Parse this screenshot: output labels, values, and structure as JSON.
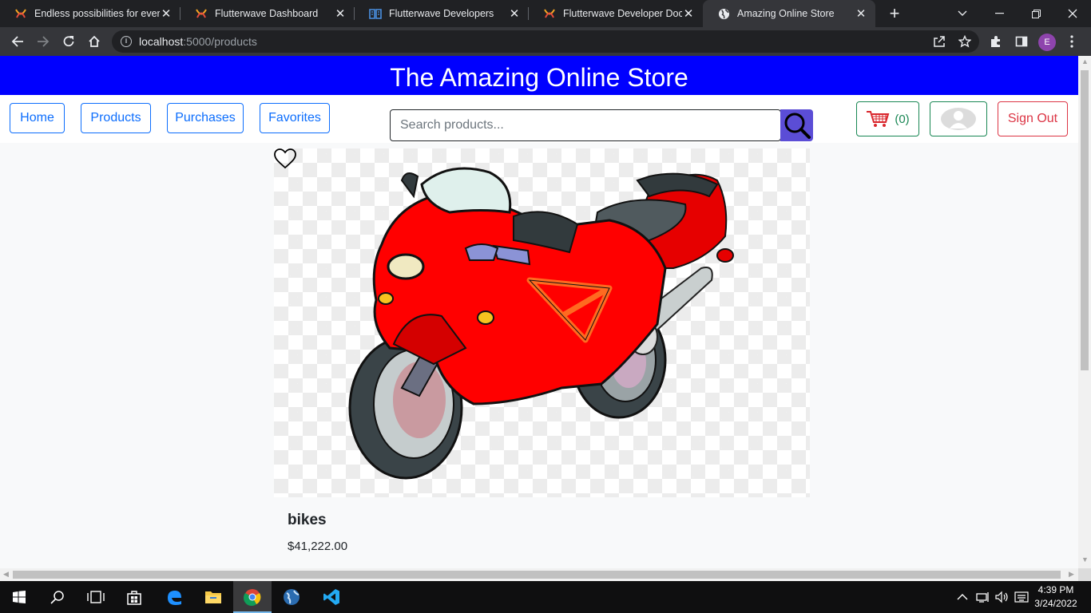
{
  "browser": {
    "tabs": [
      {
        "title": "Endless possibilities for every",
        "icon": "flutterwave-icon"
      },
      {
        "title": "Flutterwave Dashboard",
        "icon": "flutterwave-icon"
      },
      {
        "title": "Flutterwave Developers",
        "icon": "book-icon"
      },
      {
        "title": "Flutterwave Developer Docum",
        "icon": "flutterwave-icon"
      },
      {
        "title": "Amazing Online Store",
        "icon": "globe-icon",
        "active": true
      }
    ],
    "url_host": "localhost",
    "url_path": ":5000/products",
    "profile_initial": "E"
  },
  "store": {
    "title": "The Amazing Online Store",
    "nav": {
      "home": "Home",
      "products": "Products",
      "purchases": "Purchases",
      "favorites": "Favorites"
    },
    "search_placeholder": "Search products...",
    "cart_count": "(0)",
    "sign_out": "Sign Out"
  },
  "products": [
    {
      "name": "bikes",
      "price": "$41,222.00",
      "image": "red-motorcycle",
      "favorited": false
    }
  ],
  "taskbar": {
    "time": "4:39 PM",
    "date": "3/24/2022"
  },
  "colors": {
    "banner": "#0000ff",
    "primary": "#0d6efd",
    "success": "#198754",
    "danger": "#dc3545",
    "search_button": "#5b4dd6"
  }
}
